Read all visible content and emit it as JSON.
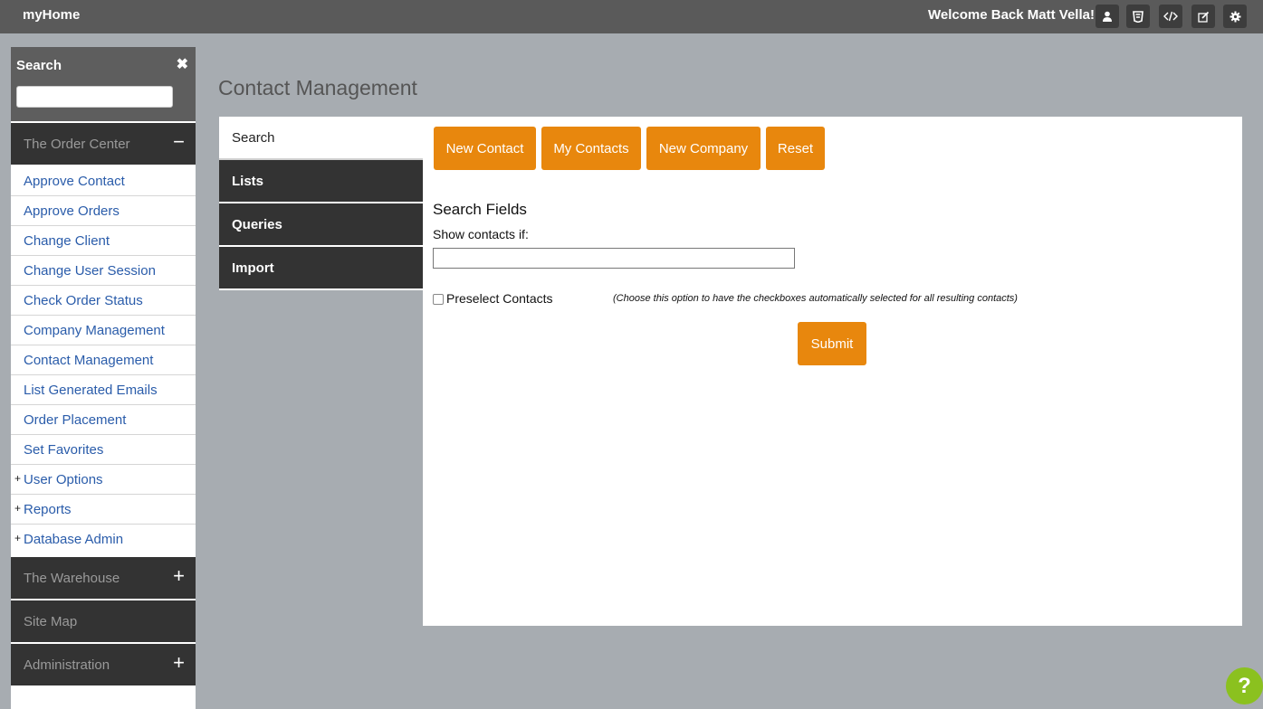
{
  "app": {
    "brand": "myHome",
    "welcome": "Welcome Back Matt Vella!"
  },
  "toolbar_icons": [
    "user-icon",
    "css3-icon",
    "code-icon",
    "edit-icon",
    "gear-icon"
  ],
  "sidebar": {
    "search_label": "Search",
    "close_glyph": "✖",
    "sections": [
      {
        "label": "The Order Center",
        "toggle": "−"
      },
      {
        "label": "The Warehouse",
        "toggle": "+"
      },
      {
        "label": "Site Map",
        "toggle": ""
      },
      {
        "label": "Administration",
        "toggle": "+"
      }
    ],
    "items": [
      {
        "label": "Approve Contact",
        "prefix": ""
      },
      {
        "label": "Approve Orders",
        "prefix": ""
      },
      {
        "label": "Change Client",
        "prefix": ""
      },
      {
        "label": "Change User Session",
        "prefix": ""
      },
      {
        "label": "Check Order Status",
        "prefix": ""
      },
      {
        "label": "Company Management",
        "prefix": ""
      },
      {
        "label": "Contact Management",
        "prefix": ""
      },
      {
        "label": "List Generated Emails",
        "prefix": ""
      },
      {
        "label": "Order Placement",
        "prefix": ""
      },
      {
        "label": "Set Favorites",
        "prefix": ""
      },
      {
        "label": "User Options",
        "prefix": "+"
      },
      {
        "label": "Reports",
        "prefix": "+"
      },
      {
        "label": "Database Admin",
        "prefix": "+"
      }
    ]
  },
  "page": {
    "title": "Contact Management"
  },
  "tabs": [
    {
      "label": "Search"
    },
    {
      "label": "Lists"
    },
    {
      "label": "Queries"
    },
    {
      "label": "Import"
    }
  ],
  "actions": {
    "new_contact": "New Contact",
    "my_contacts": "My Contacts",
    "new_company": "New Company",
    "reset": "Reset"
  },
  "form": {
    "fields_title": "Search Fields",
    "show_label": "Show contacts if:",
    "show_value": "",
    "preselect_label": "Preselect Contacts",
    "preselect_note": "(Choose this option to have the checkboxes automatically selected for all resulting contacts)",
    "submit": "Submit"
  },
  "help_glyph": "?",
  "colors": {
    "accent": "#e8870d",
    "topbar": "#5a5a5a",
    "dark": "#333333",
    "link": "#2a5caa",
    "help": "#8bc11f"
  }
}
